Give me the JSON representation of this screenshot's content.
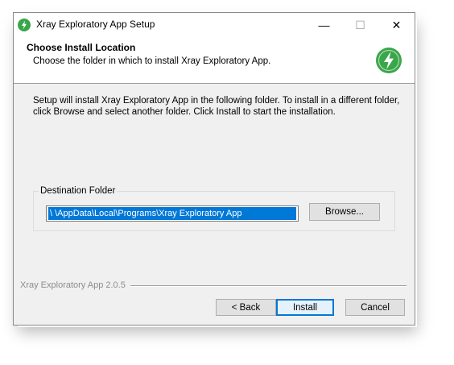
{
  "window": {
    "title": "Xray Exploratory App Setup",
    "controls": {
      "minimize": "—",
      "maximize": "☐",
      "close": "✕"
    }
  },
  "header": {
    "title": "Choose Install Location",
    "subtitle": "Choose the folder in which to install Xray Exploratory App.",
    "icon": "xray-logo-icon"
  },
  "body": {
    "description": "Setup will install Xray Exploratory App in the following folder. To install in a different folder, click Browse and select another folder. Click Install to start the installation."
  },
  "destination": {
    "group_label": "Destination Folder",
    "path_value": "\\                    \\AppData\\Local\\Programs\\Xray Exploratory App",
    "browse_label": "Browse..."
  },
  "footer": {
    "brand": "Xray Exploratory App 2.0.5",
    "back_label": "< Back",
    "install_label": "Install",
    "cancel_label": "Cancel"
  },
  "colors": {
    "accent": "#0078d7",
    "logo_green": "#3aa64a"
  }
}
